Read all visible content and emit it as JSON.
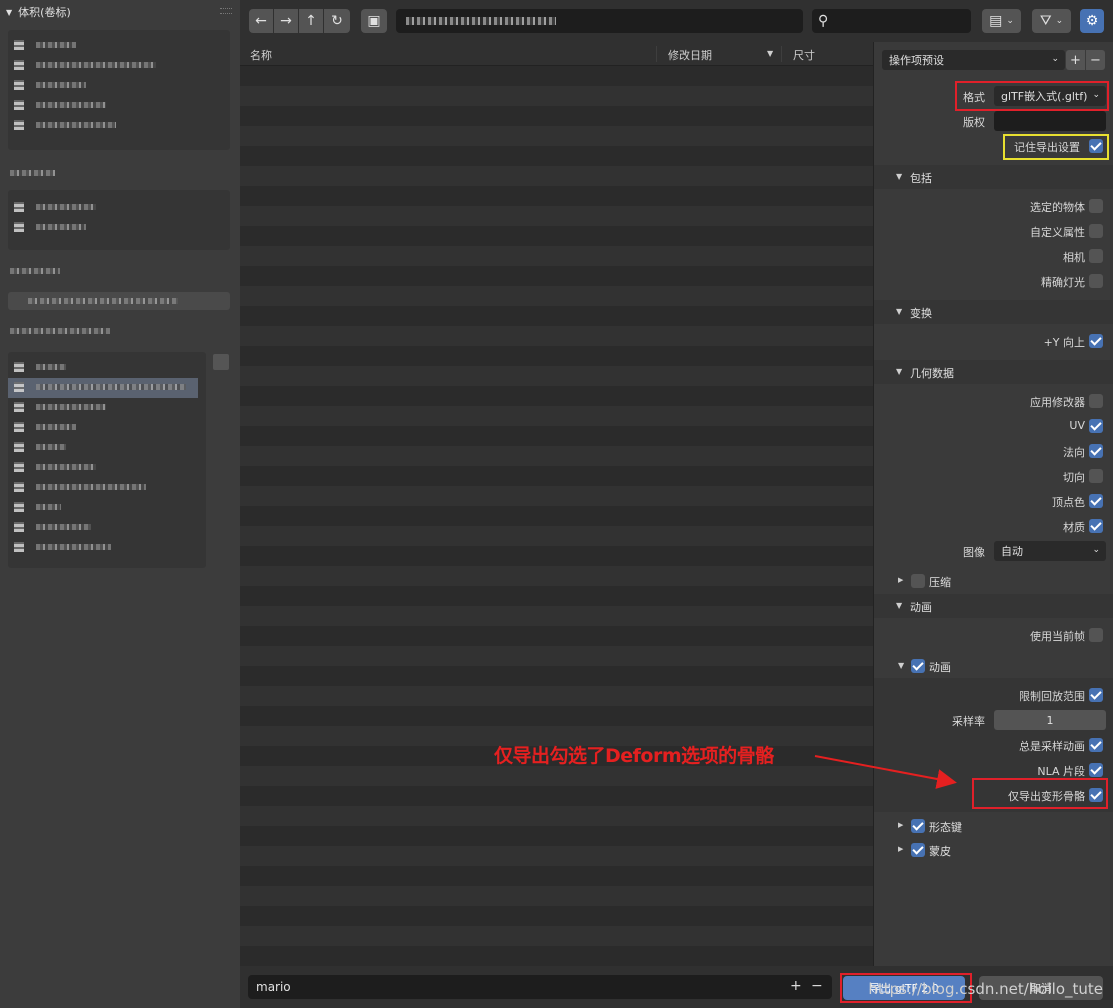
{
  "sidebar": {
    "header": "体积(卷标)"
  },
  "toolbar": {
    "back_icon": "←",
    "forward_icon": "→",
    "parent_icon": "↑",
    "refresh_icon": "↻",
    "new_folder_icon": "▣",
    "search_icon": "⚲",
    "view_icon": "▤",
    "filter_icon": "⛛",
    "settings_icon": "⚙"
  },
  "filelist": {
    "col_name": "名称",
    "col_date": "修改日期",
    "col_size": "尺寸"
  },
  "panel": {
    "preset": "操作项预设",
    "format_label": "格式",
    "format_value": "glTF嵌入式(.gltf)",
    "copyright_label": "版权",
    "remember": "记住导出设置",
    "sec_include": "包括",
    "selected_objects": "选定的物体",
    "custom_props": "自定义属性",
    "cameras": "相机",
    "punctual_lights": "精确灯光",
    "sec_transform": "变换",
    "y_up": "+Y 向上",
    "sec_geometry": "几何数据",
    "apply_modifiers": "应用修改器",
    "uv": "UV",
    "normals": "法向",
    "tangents": "切向",
    "vertex_colors": "顶点色",
    "materials": "材质",
    "images_label": "图像",
    "images_value": "自动",
    "compression": "压缩",
    "sec_animation": "动画",
    "use_current_frame": "使用当前帧",
    "animation_sub": "动画",
    "limit_playback": "限制回放范围",
    "sampling_rate_label": "采样率",
    "sampling_rate_value": "1",
    "always_sample": "总是采样动画",
    "nla_strips": "NLA 片段",
    "deform_bones": "仅导出变形骨骼",
    "shape_keys": "形态键",
    "skinning": "蒙皮"
  },
  "bottom": {
    "filename": "mario",
    "plus": "+",
    "minus": "−",
    "export": "导出 glTF 2.0",
    "cancel": "取消"
  },
  "annotation": {
    "text": "仅导出勾选了Deform选项的骨骼"
  },
  "watermark": "https://blog.csdn.net/hollo_tute"
}
